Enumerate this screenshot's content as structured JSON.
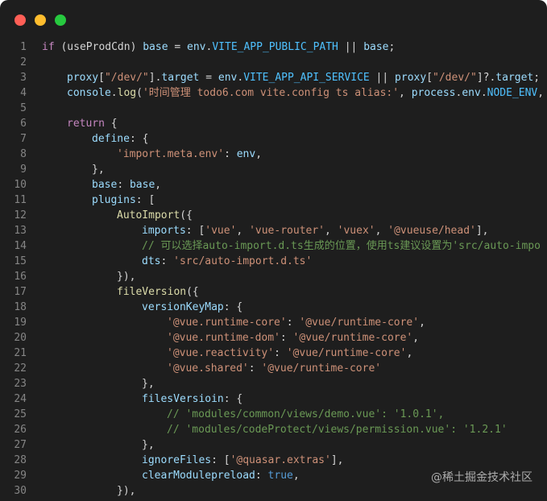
{
  "window": {
    "traffic_lights": [
      {
        "name": "close",
        "color": "#ff5f56"
      },
      {
        "name": "minimize",
        "color": "#ffbd2e"
      },
      {
        "name": "zoom",
        "color": "#27c93f"
      }
    ]
  },
  "code_lines": [
    {
      "n": "1",
      "indent": 0,
      "tokens": [
        [
          "kw",
          "if"
        ],
        [
          "p",
          " (useProdCdn) "
        ],
        [
          "var",
          "base"
        ],
        [
          "p",
          " = "
        ],
        [
          "var",
          "env"
        ],
        [
          "p",
          "."
        ],
        [
          "const",
          "VITE_APP_PUBLIC_PATH"
        ],
        [
          "p",
          " || "
        ],
        [
          "var",
          "base"
        ],
        [
          "p",
          ";"
        ]
      ]
    },
    {
      "n": "2",
      "indent": 0,
      "tokens": []
    },
    {
      "n": "3",
      "indent": 1,
      "tokens": [
        [
          "var",
          "proxy"
        ],
        [
          "p",
          "["
        ],
        [
          "str",
          "\"/dev/\""
        ],
        [
          "p",
          "]."
        ],
        [
          "var",
          "target"
        ],
        [
          "p",
          " = "
        ],
        [
          "var",
          "env"
        ],
        [
          "p",
          "."
        ],
        [
          "const",
          "VITE_APP_API_SERVICE"
        ],
        [
          "p",
          " || "
        ],
        [
          "var",
          "proxy"
        ],
        [
          "p",
          "["
        ],
        [
          "str",
          "\"/dev/\""
        ],
        [
          "p",
          "]?."
        ],
        [
          "var",
          "target"
        ],
        [
          "p",
          ";"
        ]
      ]
    },
    {
      "n": "4",
      "indent": 1,
      "tokens": [
        [
          "var",
          "console"
        ],
        [
          "p",
          "."
        ],
        [
          "fn",
          "log"
        ],
        [
          "p",
          "("
        ],
        [
          "str",
          "'时间管理 todo6.com vite.config ts alias:'"
        ],
        [
          "p",
          ", "
        ],
        [
          "var",
          "process"
        ],
        [
          "p",
          "."
        ],
        [
          "var",
          "env"
        ],
        [
          "p",
          "."
        ],
        [
          "const",
          "NODE_ENV"
        ],
        [
          "p",
          ", -"
        ]
      ]
    },
    {
      "n": "5",
      "indent": 0,
      "tokens": []
    },
    {
      "n": "6",
      "indent": 1,
      "tokens": [
        [
          "kw",
          "return"
        ],
        [
          "p",
          " {"
        ]
      ]
    },
    {
      "n": "7",
      "indent": 2,
      "tokens": [
        [
          "var",
          "define"
        ],
        [
          "p",
          ": {"
        ]
      ]
    },
    {
      "n": "8",
      "indent": 3,
      "tokens": [
        [
          "str",
          "'import.meta.env'"
        ],
        [
          "p",
          ": "
        ],
        [
          "var",
          "env"
        ],
        [
          "p",
          ","
        ]
      ]
    },
    {
      "n": "9",
      "indent": 2,
      "tokens": [
        [
          "p",
          "},"
        ]
      ]
    },
    {
      "n": "10",
      "indent": 2,
      "tokens": [
        [
          "var",
          "base"
        ],
        [
          "p",
          ": "
        ],
        [
          "var",
          "base"
        ],
        [
          "p",
          ","
        ]
      ]
    },
    {
      "n": "11",
      "indent": 2,
      "tokens": [
        [
          "var",
          "plugins"
        ],
        [
          "p",
          ": ["
        ]
      ]
    },
    {
      "n": "12",
      "indent": 3,
      "tokens": [
        [
          "fn",
          "AutoImport"
        ],
        [
          "p",
          "({"
        ]
      ]
    },
    {
      "n": "13",
      "indent": 4,
      "tokens": [
        [
          "var",
          "imports"
        ],
        [
          "p",
          ": ["
        ],
        [
          "str",
          "'vue'"
        ],
        [
          "p",
          ", "
        ],
        [
          "str",
          "'vue-router'"
        ],
        [
          "p",
          ", "
        ],
        [
          "str",
          "'vuex'"
        ],
        [
          "p",
          ", "
        ],
        [
          "str",
          "'@vueuse/head'"
        ],
        [
          "p",
          "],"
        ]
      ]
    },
    {
      "n": "14",
      "indent": 4,
      "tokens": [
        [
          "com",
          "// 可以选择auto-import.d.ts生成的位置，使用ts建议设置为'src/auto-impo"
        ]
      ]
    },
    {
      "n": "15",
      "indent": 4,
      "tokens": [
        [
          "var",
          "dts"
        ],
        [
          "p",
          ": "
        ],
        [
          "str",
          "'src/auto-import.d.ts'"
        ]
      ]
    },
    {
      "n": "16",
      "indent": 3,
      "tokens": [
        [
          "p",
          "}),"
        ]
      ]
    },
    {
      "n": "17",
      "indent": 3,
      "tokens": [
        [
          "fn",
          "fileVersion"
        ],
        [
          "p",
          "({"
        ]
      ]
    },
    {
      "n": "18",
      "indent": 4,
      "tokens": [
        [
          "var",
          "versionKeyMap"
        ],
        [
          "p",
          ": {"
        ]
      ]
    },
    {
      "n": "19",
      "indent": 5,
      "tokens": [
        [
          "str",
          "'@vue.runtime-core'"
        ],
        [
          "p",
          ": "
        ],
        [
          "str",
          "'@vue/runtime-core'"
        ],
        [
          "p",
          ","
        ]
      ]
    },
    {
      "n": "20",
      "indent": 5,
      "tokens": [
        [
          "str",
          "'@vue.runtime-dom'"
        ],
        [
          "p",
          ": "
        ],
        [
          "str",
          "'@vue/runtime-core'"
        ],
        [
          "p",
          ","
        ]
      ]
    },
    {
      "n": "21",
      "indent": 5,
      "tokens": [
        [
          "str",
          "'@vue.reactivity'"
        ],
        [
          "p",
          ": "
        ],
        [
          "str",
          "'@vue/runtime-core'"
        ],
        [
          "p",
          ","
        ]
      ]
    },
    {
      "n": "22",
      "indent": 5,
      "tokens": [
        [
          "str",
          "'@vue.shared'"
        ],
        [
          "p",
          ": "
        ],
        [
          "str",
          "'@vue/runtime-core'"
        ]
      ]
    },
    {
      "n": "23",
      "indent": 4,
      "tokens": [
        [
          "p",
          "},"
        ]
      ]
    },
    {
      "n": "24",
      "indent": 4,
      "tokens": [
        [
          "var",
          "filesVersioin"
        ],
        [
          "p",
          ": {"
        ]
      ]
    },
    {
      "n": "25",
      "indent": 5,
      "tokens": [
        [
          "com",
          "// 'modules/common/views/demo.vue': '1.0.1',"
        ]
      ]
    },
    {
      "n": "26",
      "indent": 5,
      "tokens": [
        [
          "com",
          "// 'modules/codeProtect/views/permission.vue': '1.2.1'"
        ]
      ]
    },
    {
      "n": "27",
      "indent": 4,
      "tokens": [
        [
          "p",
          "},"
        ]
      ]
    },
    {
      "n": "28",
      "indent": 4,
      "tokens": [
        [
          "var",
          "ignoreFiles"
        ],
        [
          "p",
          ": ["
        ],
        [
          "str",
          "'@quasar.extras'"
        ],
        [
          "p",
          "],"
        ]
      ]
    },
    {
      "n": "29",
      "indent": 4,
      "tokens": [
        [
          "var",
          "clearModulepreload"
        ],
        [
          "p",
          ": "
        ],
        [
          "bool",
          "true"
        ],
        [
          "p",
          ","
        ]
      ]
    },
    {
      "n": "30",
      "indent": 3,
      "tokens": [
        [
          "p",
          "}),"
        ]
      ]
    }
  ],
  "watermark": "@稀土掘金技术社区",
  "colors": {
    "background": "#1e1e1e",
    "line_number": "#858585",
    "keyword": "#c586c0",
    "variable": "#9cdcfe",
    "string": "#ce9178",
    "function": "#dcdcaa",
    "comment": "#6a9955",
    "constant": "#4fc1ff",
    "boolean": "#569cd6",
    "punctuation": "#d4d4d4"
  }
}
